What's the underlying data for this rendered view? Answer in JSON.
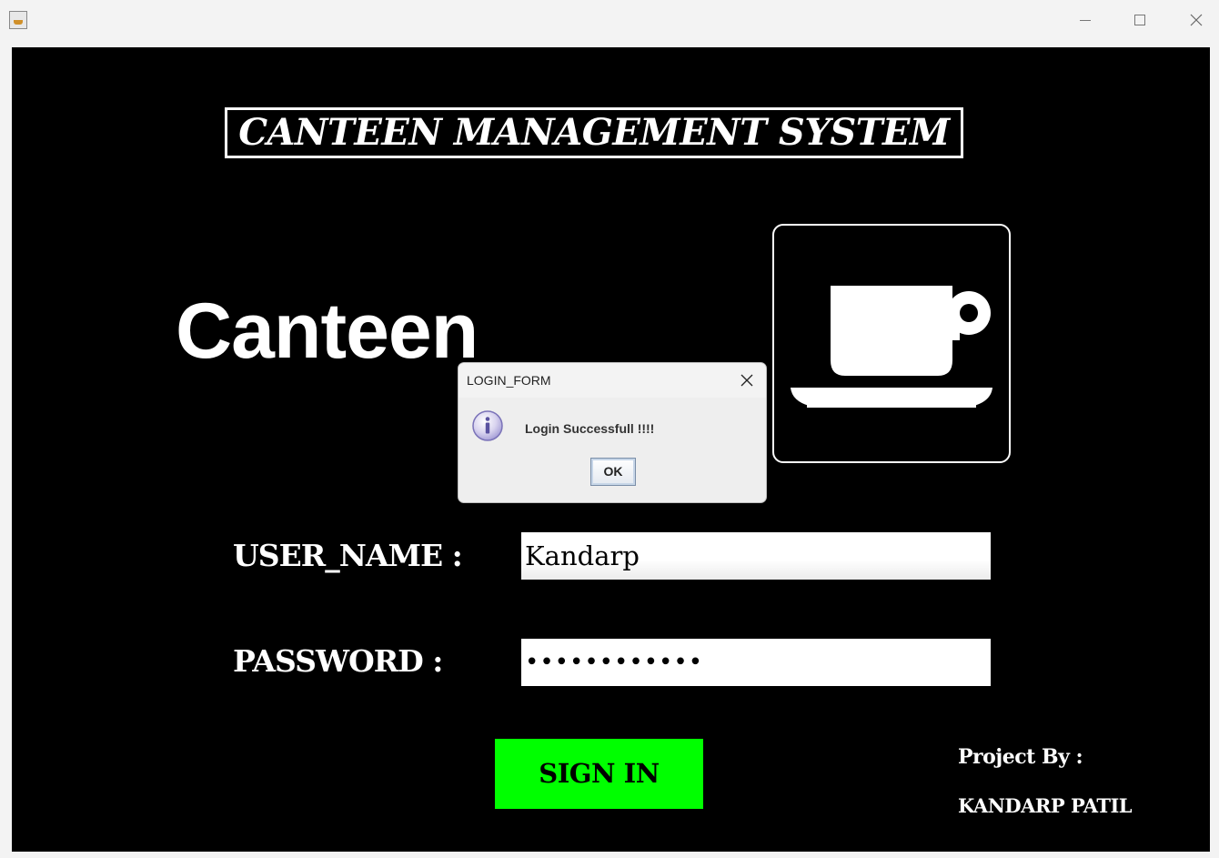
{
  "window": {
    "minimize_symbol": "—",
    "maximize_symbol": "☐",
    "close_symbol": "✕"
  },
  "app": {
    "title_banner": "CANTEEN MANAGEMENT SYSTEM",
    "logo_text": "Canteen",
    "username_label": "USER_NAME  :",
    "password_label": "PASSWORD  :",
    "username_value": "Kandarp",
    "password_value": "••••••••••••",
    "sign_in_label": "SIGN IN",
    "project_by_label": "Project By :",
    "author_name": "KANDARP PATIL"
  },
  "dialog": {
    "title": "LOGIN_FORM",
    "message": "Login Successfull !!!!",
    "ok_label": "OK"
  },
  "colors": {
    "background": "#000000",
    "accent_button": "#00ff00",
    "text": "#ffffff"
  },
  "icons": {
    "app": "java-cup-icon",
    "logo": "coffee-cup-icon",
    "dialog": "info-icon"
  }
}
